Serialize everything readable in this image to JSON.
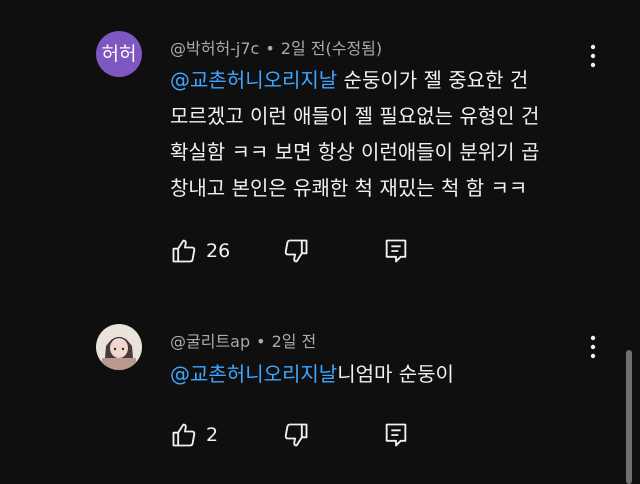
{
  "comments": [
    {
      "avatar_initials": "허허",
      "avatar_color": "#7e57c2",
      "author": "@박허허-j7c",
      "time": "2일 전(수정됨)",
      "mention": "@교촌허니오리지날",
      "text": " 순둥이가 젤 중요한 건\n모르겠고 이런 애들이 젤 필요없는 유형인 건\n확실함 ㅋㅋ 보면 항상 이런애들이 분위기 곱\n창내고 본인은 유쾌한 척 재밌는 척 함 ㅋㅋ",
      "likes": "26"
    },
    {
      "author": "@굴리트ap",
      "time": "2일 전",
      "mention": "@교촌허니오리지날",
      "text": "니엄마 순둥이",
      "likes": "2"
    }
  ],
  "separator": "•",
  "colors": {
    "background": "#0f0f0f",
    "text": "#f1f1f1",
    "secondary_text": "#aaaaaa",
    "mention": "#3ea6ff"
  },
  "icons": {
    "like": "thumbs-up-icon",
    "dislike": "thumbs-down-icon",
    "reply": "reply-comment-icon",
    "more": "kebab-menu-icon"
  }
}
